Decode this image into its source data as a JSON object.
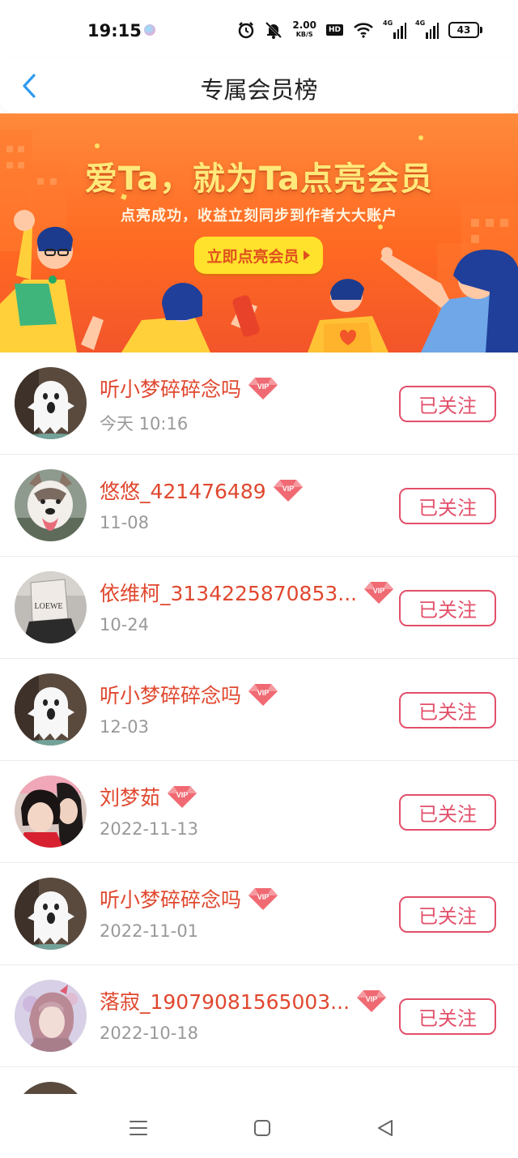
{
  "status_bar": {
    "time": "19:15",
    "net_speed_value": "2.00",
    "net_speed_unit": "KB/S",
    "hd_label": "HD",
    "signal1_label": "4G",
    "signal2_label": "4G",
    "battery": "43"
  },
  "header": {
    "title": "专属会员榜",
    "back_icon": "chevron-left-icon",
    "accent_color": "#2f9bf0"
  },
  "banner": {
    "headline": "爱Ta，就为Ta点亮会员",
    "subtitle": "点亮成功，收益立刻同步到作者大大账户",
    "cta_label": "立即点亮会员",
    "cta_icon": "play-triangle-icon",
    "colors": {
      "bg_top": "#ff8a3c",
      "bg_bottom": "#f2552a",
      "cta": "#ffe22b",
      "headline": "#ffe97a"
    }
  },
  "members": [
    {
      "name": "听小梦碎碎念吗",
      "time": "今天 10:16",
      "button": "已关注",
      "avatar": "ghost-avatar",
      "vip_icon": "vip-diamond-icon"
    },
    {
      "name": "悠悠_421476489",
      "time": "11-08",
      "button": "已关注",
      "avatar": "dog-avatar",
      "vip_icon": "vip-diamond-icon"
    },
    {
      "name": "依维柯_3134225870853...",
      "time": "10-24",
      "button": "已关注",
      "avatar": "box-head-avatar",
      "vip_icon": "vip-diamond-icon"
    },
    {
      "name": "听小梦碎碎念吗",
      "time": "12-03",
      "button": "已关注",
      "avatar": "ghost-avatar",
      "vip_icon": "vip-diamond-icon"
    },
    {
      "name": "刘梦茹",
      "time": "2022-11-13",
      "button": "已关注",
      "avatar": "selfie-avatar",
      "vip_icon": "vip-diamond-icon"
    },
    {
      "name": "听小梦碎碎念吗",
      "time": "2022-11-01",
      "button": "已关注",
      "avatar": "ghost-avatar",
      "vip_icon": "vip-diamond-icon"
    },
    {
      "name": "落寂_19079081565003...",
      "time": "2022-10-18",
      "button": "已关注",
      "avatar": "portrait-avatar",
      "vip_icon": "vip-diamond-icon"
    }
  ],
  "colors": {
    "name": "#e0482f",
    "follow_border": "#e2506a",
    "timestamp": "#999999"
  },
  "nav_bar": {
    "menu_icon": "menu-icon",
    "home_icon": "square-home-icon",
    "back_icon": "triangle-back-icon"
  }
}
